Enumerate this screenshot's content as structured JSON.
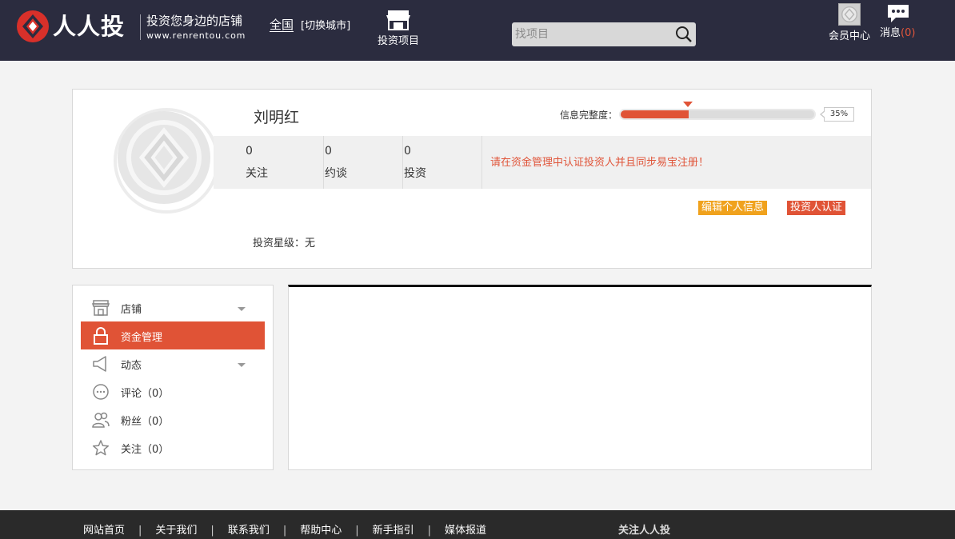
{
  "header": {
    "logo_name": "人人投",
    "logo_slogan": "投资您身边的店铺",
    "logo_url": "www.renrentou.com",
    "city": "全国",
    "city_switch": "[切换城市]",
    "nav_projects": "投资项目",
    "search_placeholder": "找项目",
    "member_center": "会员中心",
    "messages_label": "消息",
    "messages_count": "(0)"
  },
  "profile": {
    "name": "刘明红",
    "completeness_label": "信息完整度：",
    "completeness_percent": "35%",
    "completeness_fraction": 0.35,
    "stats": [
      {
        "value": "0",
        "label": "关注"
      },
      {
        "value": "0",
        "label": "约谈"
      },
      {
        "value": "0",
        "label": "投资"
      }
    ],
    "notice": "请在资金管理中认证投资人并且同步易宝注册！",
    "edit_button": "编辑个人信息",
    "verify_button": "投资人认证",
    "star_level": "投资星级：无"
  },
  "sidebar": {
    "items": [
      {
        "label": "店铺",
        "icon": "store-icon",
        "has_caret": true,
        "active": false
      },
      {
        "label": "资金管理",
        "icon": "lock-icon",
        "has_caret": false,
        "active": true
      },
      {
        "label": "动态",
        "icon": "megaphone-icon",
        "has_caret": true,
        "active": false
      },
      {
        "label": "评论（0）",
        "icon": "comment-icon",
        "has_caret": false,
        "active": false
      },
      {
        "label": "粉丝（0）",
        "icon": "users-icon",
        "has_caret": false,
        "active": false
      },
      {
        "label": "关注（0）",
        "icon": "star-icon",
        "has_caret": false,
        "active": false
      }
    ]
  },
  "footer": {
    "links": [
      "网站首页",
      "关于我们",
      "联系我们",
      "帮助中心",
      "新手指引",
      "媒体报道"
    ],
    "separator": "|",
    "follow": "关注人人投"
  },
  "colors": {
    "header_bg": "#2b2c3f",
    "accent": "#e05336",
    "edit_button": "#f0a21d",
    "footer_bg": "#2a2a2a"
  }
}
